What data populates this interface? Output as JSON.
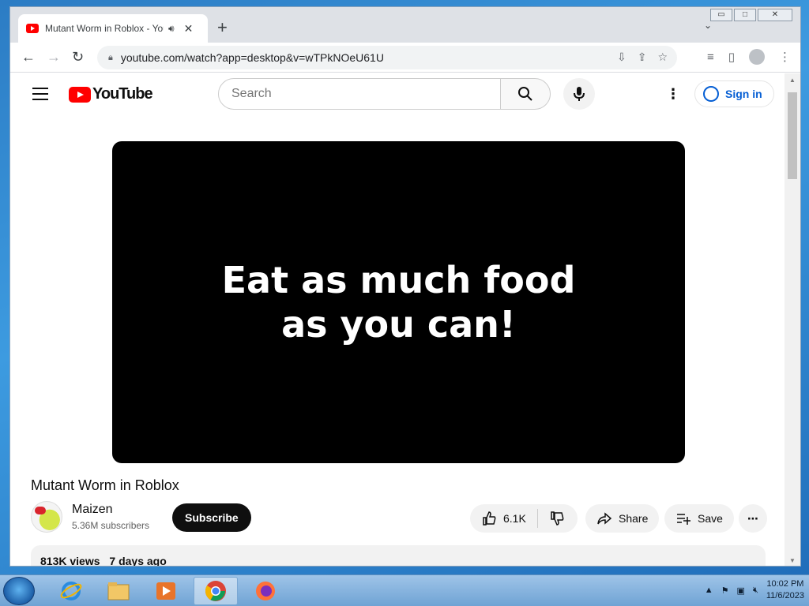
{
  "browser": {
    "tab_title": "Mutant Worm in Roblox - YouTube",
    "tab_close": "✕",
    "new_tab": "+",
    "url": "youtube.com/watch?app=desktop&v=wTPkNOeU61U",
    "window_controls": [
      "▭",
      "□",
      "✕"
    ]
  },
  "youtube": {
    "logo_text": "YouTube",
    "search_placeholder": "Search",
    "sign_in_label": "Sign in",
    "video_caption": "Eat as much food\nas you can!",
    "video_title": "Mutant Worm in Roblox",
    "channel_name": "Maizen",
    "subscribers": "5.36M subscribers",
    "subscribe_label": "Subscribe",
    "like_count": "6.1K",
    "share_label": "Share",
    "save_label": "Save",
    "views": "813K views",
    "uploaded": "7 days ago"
  },
  "taskbar": {
    "time": "10:02 PM",
    "date": "11/6/2023"
  },
  "colors": {
    "yt_red": "#ff0000",
    "link_blue": "#065fd4",
    "subscribe_bg": "#0f0f0f"
  },
  "icons": [
    "menu-icon",
    "search-icon",
    "mic-icon",
    "kebab-icon",
    "person-icon",
    "thumbs-up-icon",
    "thumbs-down-icon",
    "share-icon",
    "playlist-add-icon",
    "ellipsis-icon"
  ]
}
